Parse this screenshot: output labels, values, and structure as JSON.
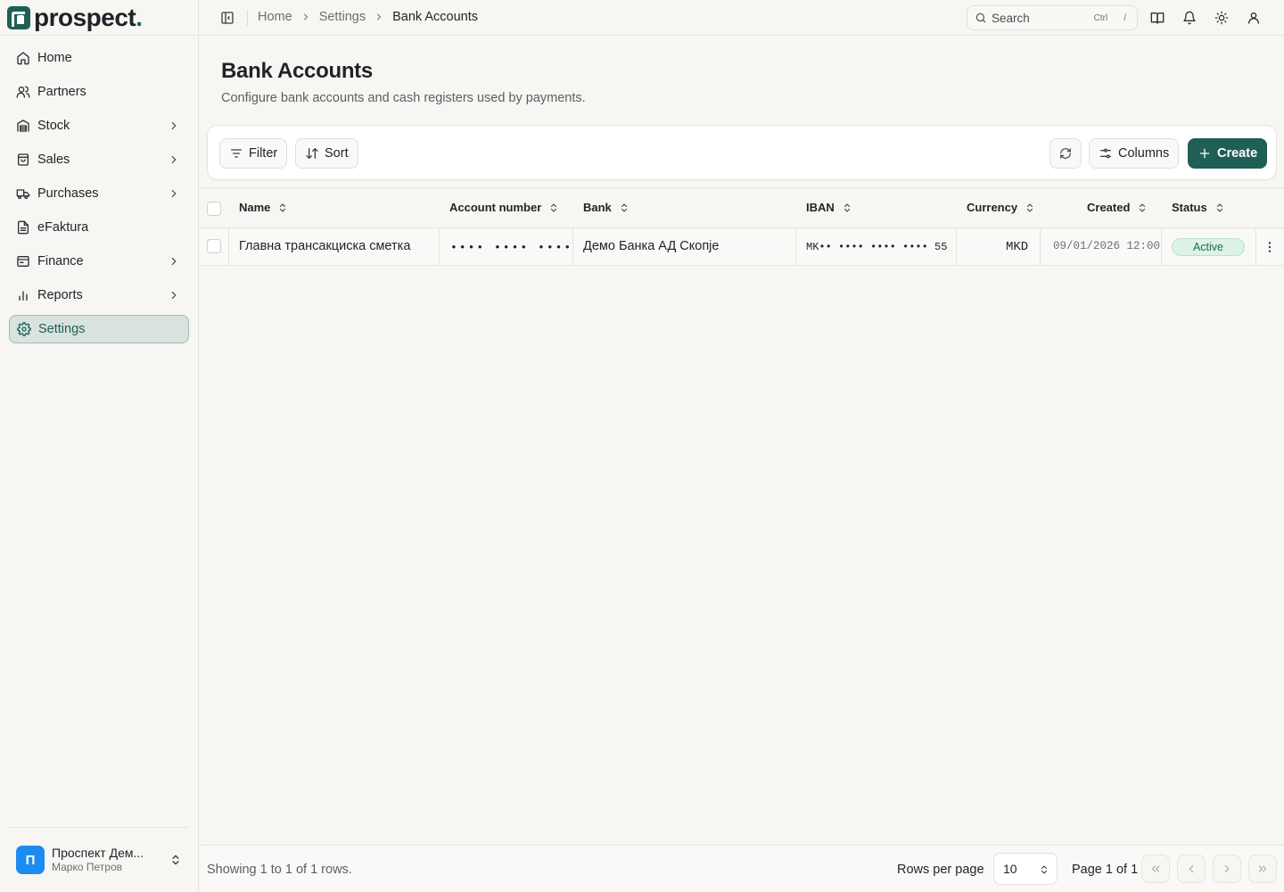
{
  "brand": {
    "name": "prospect",
    "dot": "."
  },
  "sidebar": {
    "items": [
      {
        "label": "Home",
        "icon": "home-icon",
        "has_children": false
      },
      {
        "label": "Partners",
        "icon": "users-icon",
        "has_children": false
      },
      {
        "label": "Stock",
        "icon": "warehouse-icon",
        "has_children": true
      },
      {
        "label": "Sales",
        "icon": "shopping-bag-icon",
        "has_children": true
      },
      {
        "label": "Purchases",
        "icon": "truck-icon",
        "has_children": true
      },
      {
        "label": "eFaktura",
        "icon": "document-icon",
        "has_children": false
      },
      {
        "label": "Finance",
        "icon": "wallet-icon",
        "has_children": true
      },
      {
        "label": "Reports",
        "icon": "bar-chart-icon",
        "has_children": true
      },
      {
        "label": "Settings",
        "icon": "gear-icon",
        "has_children": false,
        "active": true
      }
    ],
    "account": {
      "avatar_letter": "П",
      "name": "Проспект Дем...",
      "user": "Марко Петров"
    }
  },
  "topbar": {
    "breadcrumbs": [
      "Home",
      "Settings",
      "Bank Accounts"
    ],
    "search": {
      "placeholder": "Search",
      "shortcut_ctrl": "Ctrl",
      "shortcut_key": "/"
    }
  },
  "page": {
    "title": "Bank Accounts",
    "subtitle": "Configure bank accounts and cash registers used by payments."
  },
  "toolbar": {
    "filter_label": "Filter",
    "sort_label": "Sort",
    "columns_label": "Columns",
    "create_label": "Create"
  },
  "table": {
    "columns": [
      "Name",
      "Account number",
      "Bank",
      "IBAN",
      "Currency",
      "Created",
      "Status"
    ],
    "rows": [
      {
        "name": "Главна трансакциска сметка",
        "account_number": "•••• •••• ••••",
        "bank": "Демо Банка АД Скопје",
        "iban": "MK•• •••• •••• •••• 55",
        "currency": "MKD",
        "created": "09/01/2026 12:00",
        "status": "Active"
      }
    ]
  },
  "footer": {
    "showing": "Showing 1 to 1 of 1 rows.",
    "rows_per_page_label": "Rows per page",
    "rows_per_page_value": "10",
    "page_info": "Page 1 of 1"
  },
  "colors": {
    "accent": "#1f5f55",
    "active_badge_bg": "#dcf3e6",
    "active_badge_text": "#1f6b48",
    "avatar": "#1d8cf0"
  }
}
